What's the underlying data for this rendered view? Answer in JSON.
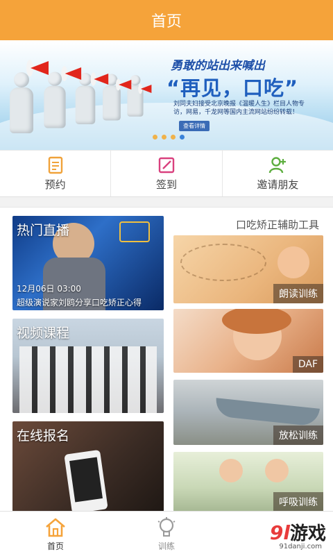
{
  "header": {
    "title": "首页"
  },
  "banner": {
    "line1": "勇敢的站出来喊出",
    "line2": "“再见，口吃”",
    "line3": "刘同夫妇接受北京晚报《温暖人生》栏目人物专访，网易，千龙网等国内主流网站纷纷转载！",
    "button": "查看详情",
    "dots_active_index": 3
  },
  "actions": [
    {
      "label": "预约",
      "icon": "appointment-icon"
    },
    {
      "label": "签到",
      "icon": "checkin-icon"
    },
    {
      "label": "邀请朋友",
      "icon": "invite-friend-icon"
    }
  ],
  "tools_title": "口吃矫正辅助工具",
  "live": {
    "title": "热门直播",
    "date": "12月06日 03:00",
    "desc": "超级演说家刘鸥分享口吃矫正心得"
  },
  "video": {
    "title": "视频课程"
  },
  "signup": {
    "title": "在线报名"
  },
  "tools": [
    {
      "label": "朗读训练"
    },
    {
      "label": "DAF"
    },
    {
      "label": "放松训练"
    },
    {
      "label": "呼吸训练"
    }
  ],
  "tabbar": [
    {
      "label": "首页",
      "icon": "home-icon",
      "active": true
    },
    {
      "label": "训练",
      "icon": "lightbulb-icon",
      "active": false
    }
  ],
  "watermark": {
    "brand_num": "9l",
    "brand_text": "游戏",
    "url": "91danji.com"
  },
  "colors": {
    "header": "#f5a33a",
    "accent": "#f5a33a",
    "active_dot": "#3b83d9"
  }
}
